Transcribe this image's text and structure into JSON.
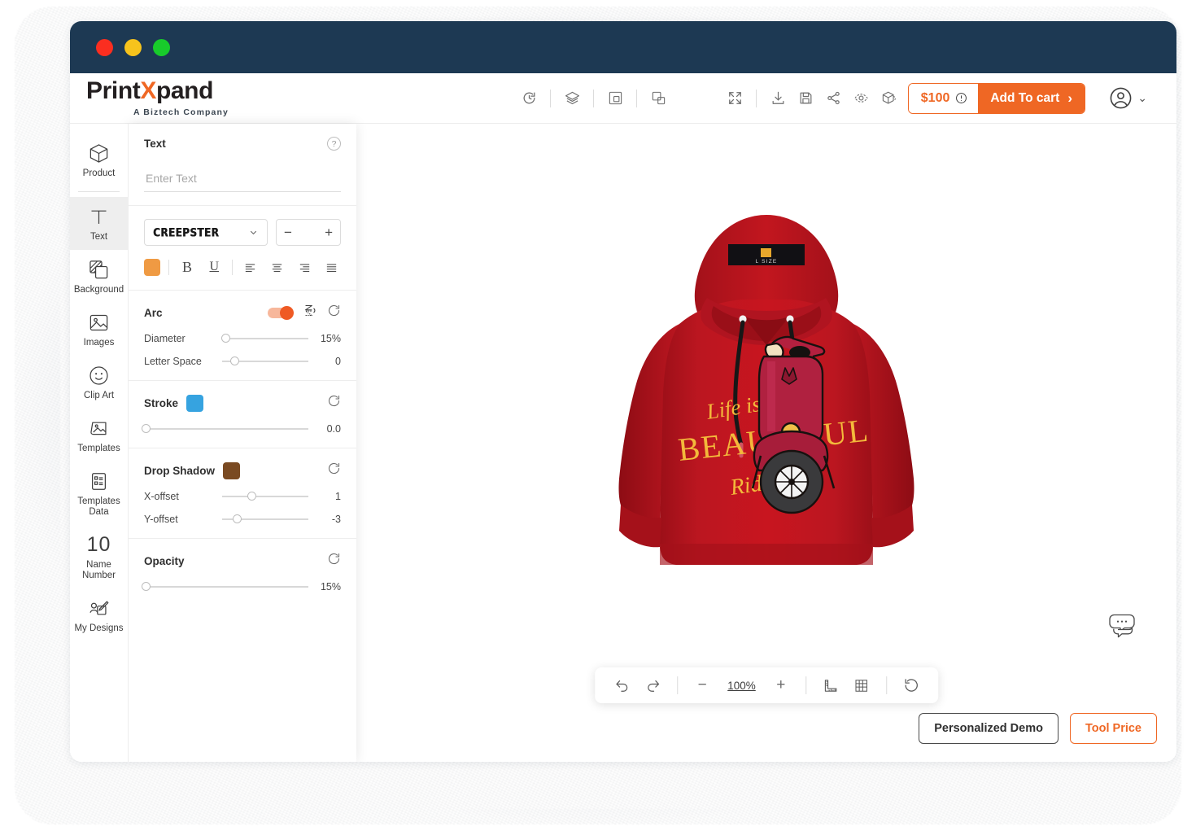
{
  "window": {
    "traffic_lights": [
      "close",
      "minimize",
      "maximize"
    ]
  },
  "brand": {
    "name_part1": "Print",
    "name_x": "X",
    "name_part2": "pand",
    "tagline": "A Biztech Company"
  },
  "header": {
    "center_tools": [
      {
        "name": "history-icon",
        "label": "History"
      },
      {
        "name": "layers-icon",
        "label": "Layers"
      },
      {
        "name": "group-icon",
        "label": "Group"
      },
      {
        "name": "ungroup-icon",
        "label": "Ungroup"
      }
    ],
    "right_tools": [
      {
        "name": "fullscreen-icon",
        "label": "Fullscreen"
      },
      {
        "name": "download-icon",
        "label": "Download"
      },
      {
        "name": "save-icon",
        "label": "Save"
      },
      {
        "name": "share-icon",
        "label": "Share"
      },
      {
        "name": "preview-icon",
        "label": "Preview"
      },
      {
        "name": "view-3d-icon",
        "label": "3D View"
      }
    ],
    "price": "$100",
    "add_to_cart": "Add To cart",
    "cart_arrow": "›",
    "account_chevron": "⌄"
  },
  "sidebar": {
    "items": [
      {
        "label": "Product",
        "icon": "cube-icon",
        "active": false
      },
      {
        "label": "Text",
        "icon": "text-t-icon",
        "active": true
      },
      {
        "label": "Background",
        "icon": "background-icon",
        "active": false
      },
      {
        "label": "Images",
        "icon": "image-icon",
        "active": false
      },
      {
        "label": "Clip Art",
        "icon": "smiley-icon",
        "active": false
      },
      {
        "label": "Templates",
        "icon": "templates-icon",
        "active": false
      },
      {
        "label": "Templates Data",
        "icon": "clipboard-icon",
        "active": false
      },
      {
        "label": "Name Number",
        "icon": "number-10-icon",
        "glyph": "10",
        "active": false
      },
      {
        "label": "My Designs",
        "icon": "my-designs-icon",
        "active": false
      }
    ]
  },
  "panel": {
    "title": "Text",
    "help": "?",
    "input_placeholder": "Enter Text",
    "input_value": "",
    "font": {
      "selected": "CREEPSTER",
      "chevron": "⌄",
      "minus": "−",
      "plus": "+"
    },
    "format": {
      "color": "#ef9a43",
      "bold": "B",
      "underline": "U",
      "align": [
        "align-left",
        "align-center",
        "align-right",
        "align-justify"
      ]
    },
    "arc": {
      "title": "Arc",
      "enabled": true,
      "flip_icon": "arc-flip-icon",
      "reset_icon": "reset-icon",
      "diameter_label": "Diameter",
      "diameter_value": "15%",
      "diameter_pct": 4,
      "letter_space_label": "Letter Space",
      "letter_space_value": "0",
      "letter_space_pct": 14
    },
    "stroke": {
      "title": "Stroke",
      "color": "#36a3e0",
      "value": "0.0",
      "pct": 0
    },
    "drop_shadow": {
      "title": "Drop Shadow",
      "color": "#7a4a22",
      "x_label": "X-offset",
      "x_value": "1",
      "x_pct": 34,
      "y_label": "Y-offset",
      "y_value": "-3",
      "y_pct": 17
    },
    "opacity": {
      "title": "Opacity",
      "value": "15%",
      "pct": 0
    }
  },
  "canvas": {
    "product": {
      "type": "hoodie",
      "color": "#c0161f",
      "neck_label": "L SIZE"
    },
    "design": {
      "line1": "Life is a",
      "line2": "BEAUTIFUL",
      "line3": "Ride",
      "text_color": "#f3b93b",
      "artwork": "vespa-scooter"
    }
  },
  "bottom_toolbar": {
    "undo": "undo-icon",
    "redo": "redo-icon",
    "zoom_out": "−",
    "zoom_value": "100%",
    "zoom_in": "+",
    "ruler": "ruler-icon",
    "grid": "grid-icon",
    "reset": "reset-icon"
  },
  "footer": {
    "demo_button": "Personalized Demo",
    "price_button": "Tool Price",
    "chat_icon": "chat-bubble-icon"
  }
}
